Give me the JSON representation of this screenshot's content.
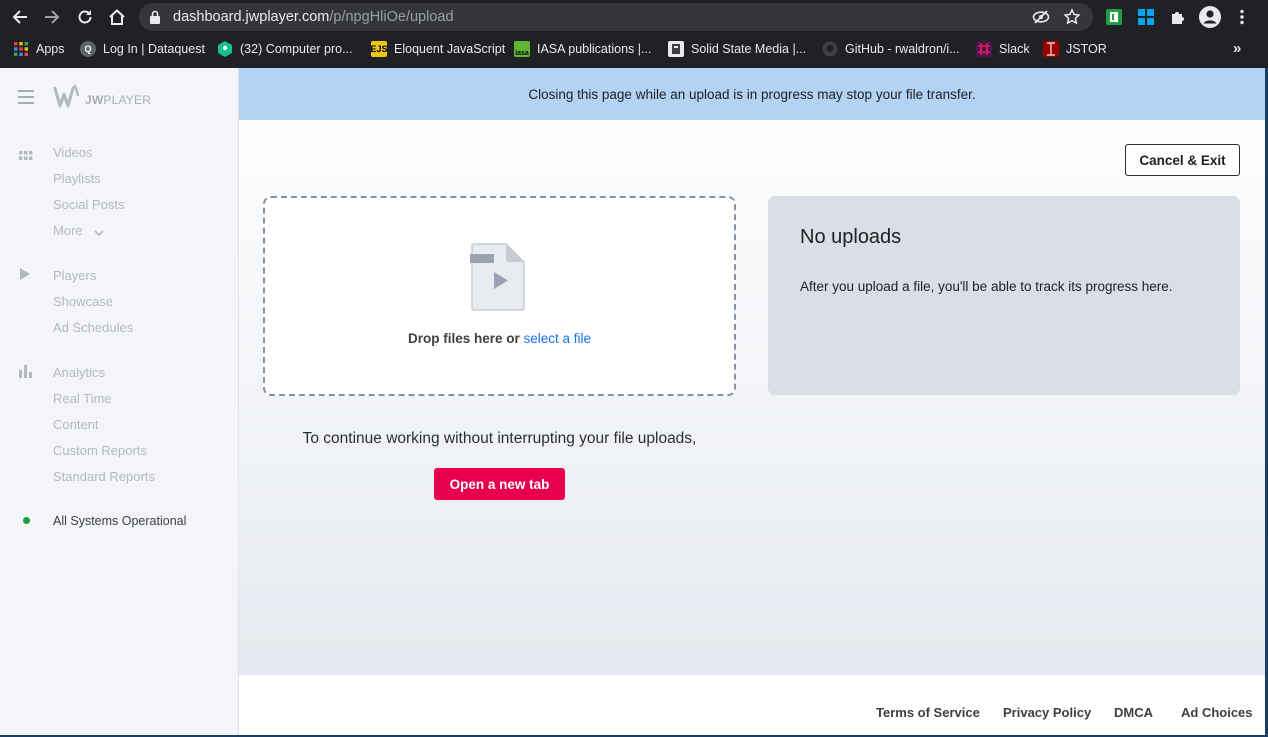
{
  "browser": {
    "url_host": "dashboard.jwplayer.com",
    "url_path": "/p/npgHliOe/upload",
    "bookmarks": [
      {
        "label": "Apps",
        "icon": "apps-grid-icon"
      },
      {
        "label": "Log In | Dataquest",
        "icon": "dataquest-icon"
      },
      {
        "label": "(32) Computer pro...",
        "icon": "khan-academy-icon"
      },
      {
        "label": "Eloquent JavaScript",
        "icon": "ejs-icon"
      },
      {
        "label": "IASA publications |...",
        "icon": "iasa-icon"
      },
      {
        "label": "Solid State Media |...",
        "icon": "solid-state-icon"
      },
      {
        "label": "GitHub - rwaldron/i...",
        "icon": "github-icon"
      },
      {
        "label": "Slack",
        "icon": "slack-icon"
      },
      {
        "label": "JSTOR",
        "icon": "jstor-icon"
      }
    ],
    "more_bookmarks": "»"
  },
  "sidebar": {
    "logo_prefix": "JW",
    "logo_suffix": "PLAYER",
    "sections": {
      "videos": {
        "head": "Videos",
        "items": [
          "Playlists",
          "Social Posts",
          "More"
        ]
      },
      "players": {
        "head": "Players",
        "items": [
          "Showcase",
          "Ad Schedules"
        ]
      },
      "analytics": {
        "head": "Analytics",
        "items": [
          "Real Time",
          "Content",
          "Custom Reports",
          "Standard Reports"
        ]
      }
    },
    "status": "All Systems Operational"
  },
  "main": {
    "banner": "Closing this page while an upload is in progress may stop your file transfer.",
    "cancel_label": "Cancel & Exit",
    "drop_text": "Drop files here or",
    "drop_link": "select a file",
    "continue_text": "To continue working without interrupting your file uploads,",
    "new_tab_label": "Open a new tab",
    "uploads_title": "No uploads",
    "uploads_desc": "After you upload a file, you'll be able to track its progress here."
  },
  "footer": {
    "links": [
      "Terms of Service",
      "Privacy Policy",
      "DMCA",
      "Ad Choices"
    ]
  },
  "colors": {
    "banner_bg": "#b2d3f4",
    "primary_button": "#e8004c",
    "link": "#1a73e8",
    "status_ok": "#1a9e3f"
  }
}
